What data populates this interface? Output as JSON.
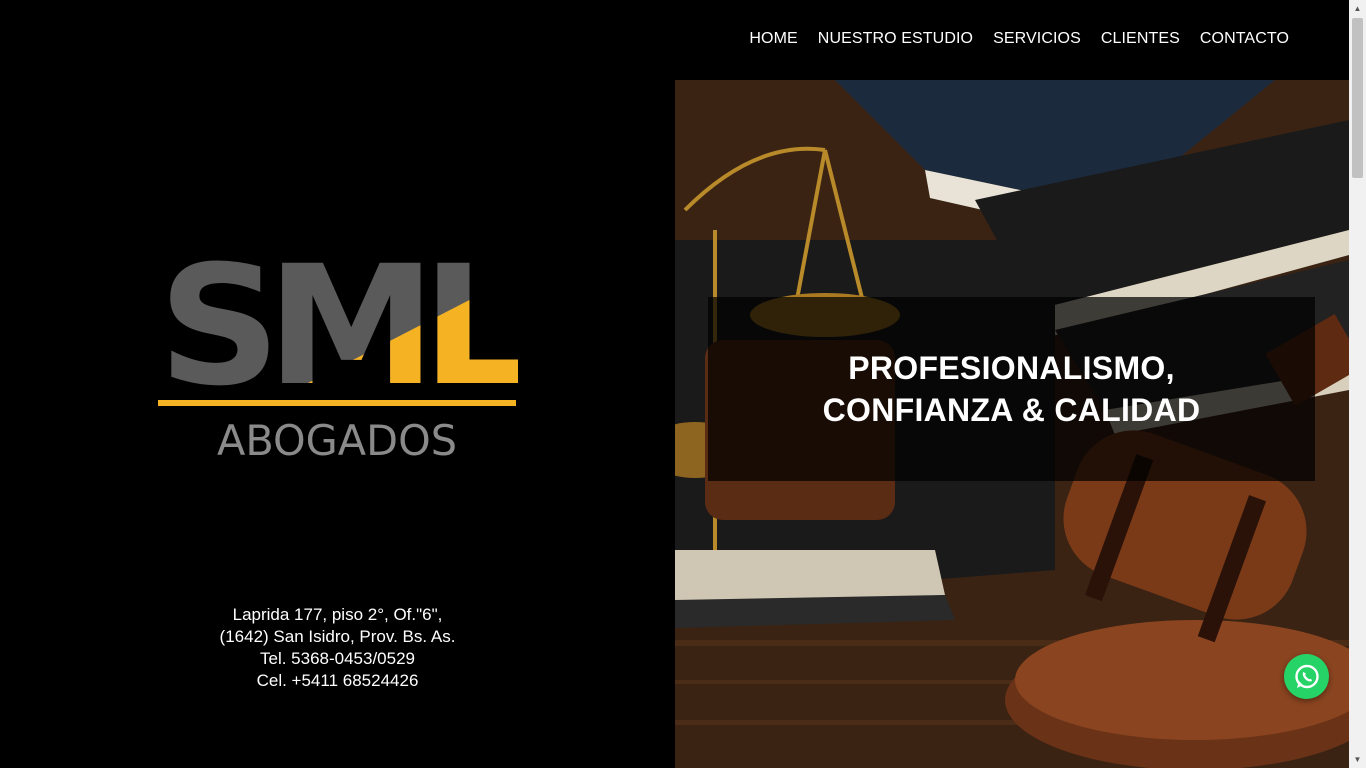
{
  "nav": {
    "items": [
      {
        "label": "HOME"
      },
      {
        "label": "NUESTRO ESTUDIO"
      },
      {
        "label": "SERVICIOS"
      },
      {
        "label": "CLIENTES"
      },
      {
        "label": "CONTACTO"
      }
    ]
  },
  "logo": {
    "mark": "SML",
    "subtitle": "ABOGADOS"
  },
  "address": {
    "line1": "Laprida 177, piso 2°, Of.\"6\",",
    "line2": "(1642) San Isidro, Prov. Bs. As.",
    "line3": "Tel. 5368-0453/0529",
    "line4": "Cel. +5411 68524426"
  },
  "hero": {
    "tagline_line1": "PROFESIONALISMO,",
    "tagline_line2": "CONFIANZA & CALIDAD"
  },
  "colors": {
    "accent": "#f5b324",
    "logo_gray": "#5a5a5a",
    "whatsapp": "#25d366"
  },
  "icons": {
    "whatsapp": "whatsapp-icon"
  }
}
